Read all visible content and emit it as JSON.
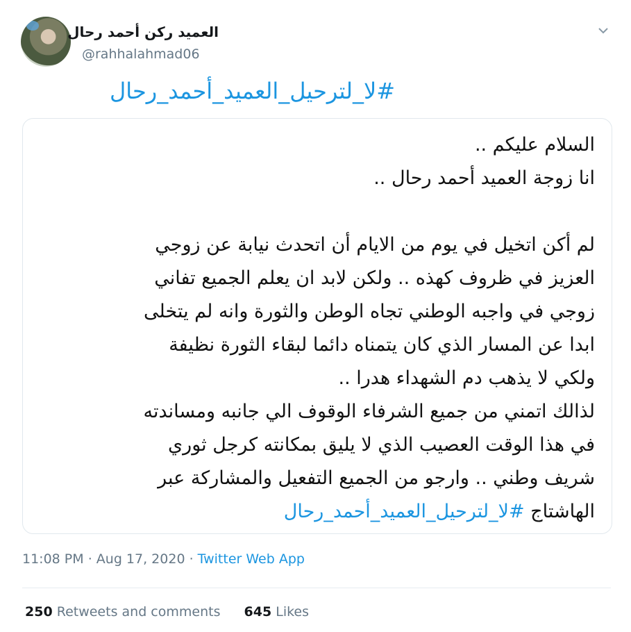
{
  "tweet": {
    "author": {
      "display_name": "العميد ركن أحمد رحال",
      "handle": "@rahhalahmad06"
    },
    "hashtag": "#لا_لترحيل_العميد_أحمد_رحال",
    "image_text": {
      "lines": [
        "السلام عليكم ..",
        "انا زوجة العميد أحمد رحال ..",
        "",
        "لم أكن اتخيل في يوم من الايام أن اتحدث نيابة عن زوجي",
        "العزيز في ظروف كهذه .. ولكن لابد ان يعلم الجميع تفاني",
        "زوجي في واجبه الوطني تجاه الوطن والثورة وانه لم يتخلى",
        "ابدا عن المسار الذي كان يتمناه دائما لبقاء الثورة نظيفة",
        "ولكي لا يذهب دم الشهداء هدرا ..",
        "لذالك اتمني من جميع الشرفاء الوقوف الي جانبه ومساندته",
        "في هذا الوقت العصيب الذي لا يليق بمكانته كرجل ثوري",
        "شريف وطني .. وارجو من الجميع التفعيل والمشاركة عبر"
      ],
      "last_line_prefix": "الهاشتاج",
      "last_line_tag": "#لا_لترحيل_العميد_أحمد_رحال"
    },
    "meta": {
      "time": "11:08 PM",
      "separator1": " · ",
      "date": "Aug 17, 2020",
      "separator2": " · ",
      "source": "Twitter Web App"
    },
    "stats": {
      "retweets_count": "250",
      "retweets_label": "Retweets and comments",
      "likes_count": "645",
      "likes_label": "Likes"
    }
  }
}
